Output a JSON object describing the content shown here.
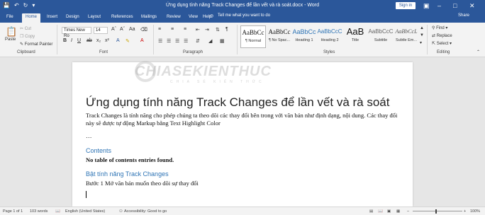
{
  "window": {
    "title": "Ứng dụng tính năng Track Changes để lần vết và rà soát.docx - Word",
    "sign_in": "Sign in"
  },
  "tabs": [
    "File",
    "Home",
    "Insert",
    "Design",
    "Layout",
    "References",
    "Mailings",
    "Review",
    "View",
    "Help"
  ],
  "tell_me": "Tell me what you want to do",
  "share": "Share",
  "clipboard": {
    "paste": "Paste",
    "cut": "Cut",
    "copy": "Copy",
    "format_painter": "Format Painter",
    "label": "Clipboard"
  },
  "font": {
    "name": "Times New Ro",
    "size": "14",
    "label": "Font"
  },
  "paragraph": {
    "label": "Paragraph"
  },
  "styles": {
    "label": "Styles",
    "items": [
      {
        "preview": "AaBbCc",
        "name": "¶ Normal"
      },
      {
        "preview": "AaBbCc",
        "name": "¶ No Spac..."
      },
      {
        "preview": "AaBbCc",
        "name": "Heading 1"
      },
      {
        "preview": "AaBbCcC",
        "name": "Heading 2"
      },
      {
        "preview": "AaB",
        "name": "Title"
      },
      {
        "preview": "AaBbCcC",
        "name": "Subtitle"
      },
      {
        "preview": "AaBbCcL",
        "name": "Subtle Em..."
      }
    ]
  },
  "editing": {
    "find": "Find",
    "replace": "Replace",
    "select": "Select",
    "label": "Editing"
  },
  "document": {
    "watermark": "CHIASEKIENTHUC",
    "watermark_sub": "CHIA SẺ KIẾN THỨC",
    "title": "Ứng dụng tính năng Track Changes để lần vết và rà soát",
    "intro": "Track Changes là tính năng cho phép chúng ta theo dõi các thay đổi bên trong với văn bản như định dạng, nội dung. Các thay đổi này sẽ được tự động Markup bằng Text Highlight Color",
    "ellipsis": "…",
    "contents_heading": "Contents",
    "toc_note": "No table of contents entries found.",
    "section_heading": "Bật tính năng Track Changes",
    "step1": "Bước 1 Mở văn bản muốn theo dõi sự thay đổi"
  },
  "status": {
    "page": "Page 1 of 1",
    "words": "103 words",
    "language": "English (United States)",
    "accessibility": "Accessibility: Good to go",
    "zoom": "100%"
  }
}
